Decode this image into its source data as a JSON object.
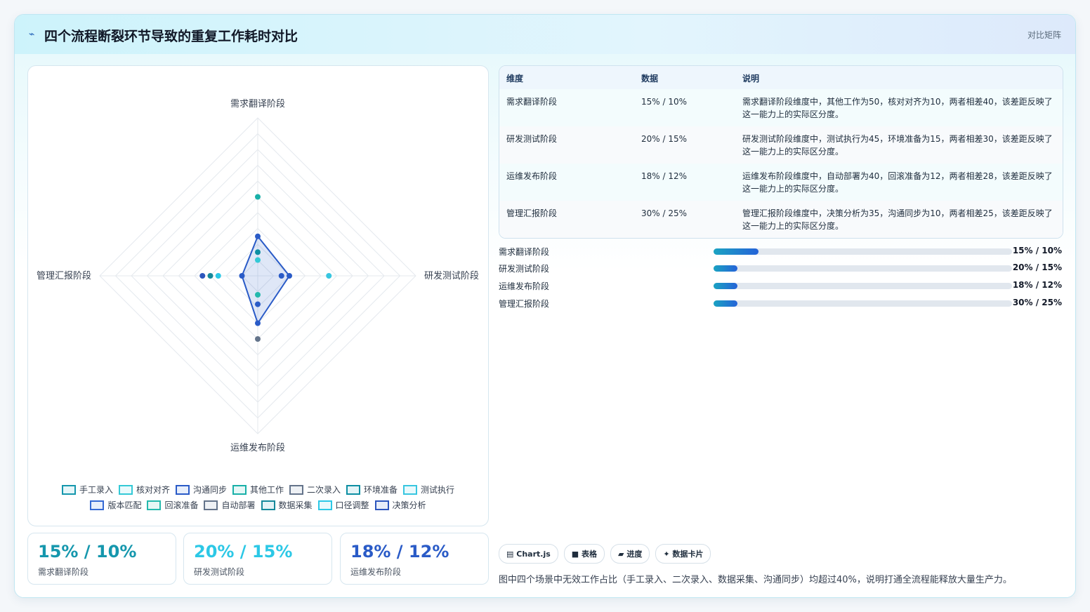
{
  "header": {
    "icon": "chart-line-icon",
    "title": "四个流程断裂环节导致的重复工作耗时对比",
    "tag": "对比矩阵"
  },
  "chart_data": {
    "type": "radar",
    "axes": [
      "需求翻译阶段",
      "研发测试阶段",
      "运维发布阶段",
      "管理汇报阶段"
    ],
    "rmax": 100,
    "rings": 10,
    "series": [
      {
        "name": "手工录入",
        "color": "#1597ad",
        "values": [
          null,
          null,
          null,
          null
        ]
      },
      {
        "name": "核对对齐",
        "color": "#34c9d6",
        "values": [
          10,
          null,
          null,
          null
        ]
      },
      {
        "name": "沟通同步",
        "color": "#2a5bc7",
        "values": [
          null,
          null,
          null,
          10
        ]
      },
      {
        "name": "其他工作",
        "color": "#19b0a8",
        "values": [
          50,
          null,
          null,
          null
        ]
      },
      {
        "name": "二次录入",
        "color": "#64748b",
        "values": [
          null,
          null,
          null,
          null
        ]
      },
      {
        "name": "环境准备",
        "color": "#0e8fa3",
        "values": [
          null,
          15,
          null,
          null
        ]
      },
      {
        "name": "测试执行",
        "color": "#38c6e0",
        "values": [
          null,
          45,
          null,
          null
        ]
      },
      {
        "name": "版本匹配",
        "color": "#3569d4",
        "values": [
          null,
          null,
          null,
          null
        ]
      },
      {
        "name": "回滚准备",
        "color": "#25b9ad",
        "values": [
          null,
          null,
          12,
          null
        ]
      },
      {
        "name": "自动部署",
        "color": "#64748b",
        "values": [
          null,
          null,
          40,
          null
        ]
      },
      {
        "name": "数据采集",
        "color": "#15899b",
        "values": [
          null,
          null,
          null,
          30
        ]
      },
      {
        "name": "口径调整",
        "color": "#2cc8e6",
        "values": [
          null,
          null,
          null,
          25
        ]
      },
      {
        "name": "决策分析",
        "color": "#2d56bd",
        "values": [
          null,
          null,
          null,
          35
        ]
      }
    ],
    "filled_series": {
      "color": "#2a5bc7",
      "values": [
        25,
        20,
        30,
        10
      ]
    },
    "extra_points": [
      {
        "axis": 0,
        "value": 15,
        "color": "#0e8fa3"
      },
      {
        "axis": 0,
        "value": 10,
        "color": "#34c9d6"
      },
      {
        "axis": 1,
        "value": 15,
        "color": "#2a5bc7"
      },
      {
        "axis": 2,
        "value": 18,
        "color": "#2a5bc7"
      },
      {
        "axis": 2,
        "value": 12,
        "color": "#25b9ad"
      },
      {
        "axis": 3,
        "value": 25,
        "color": "#2cc8e6"
      },
      {
        "axis": 3,
        "value": 30,
        "color": "#15899b"
      },
      {
        "axis": 3,
        "value": 35,
        "color": "#2d56bd"
      },
      {
        "axis": 1,
        "value": 45,
        "color": "#38c6e0"
      },
      {
        "axis": 2,
        "value": 40,
        "color": "#64748b"
      },
      {
        "axis": 0,
        "value": 50,
        "color": "#19b0a8"
      }
    ]
  },
  "legend": {
    "row1": [
      {
        "label": "手工录入",
        "border": "#1597ad",
        "fill": "#e6f6f9"
      },
      {
        "label": "核对对齐",
        "border": "#34c9d6",
        "fill": "#e9fafc"
      },
      {
        "label": "沟通同步",
        "border": "#2a5bc7",
        "fill": "#e7eefb"
      },
      {
        "label": "其他工作",
        "border": "#19b0a8",
        "fill": "#e6f7f6"
      },
      {
        "label": "二次录入",
        "border": "#64748b",
        "fill": "#eef1f5"
      },
      {
        "label": "环境准备",
        "border": "#0e8fa3",
        "fill": "#e4f4f7"
      },
      {
        "label": "测试执行",
        "border": "#38c6e0",
        "fill": "#e9f9fc"
      }
    ],
    "row2": [
      {
        "label": "版本匹配",
        "border": "#3569d4",
        "fill": "#e8eefb"
      },
      {
        "label": "回滚准备",
        "border": "#25b9ad",
        "fill": "#e6f7f5"
      },
      {
        "label": "自动部署",
        "border": "#64748b",
        "fill": "#eef1f5"
      },
      {
        "label": "数据采集",
        "border": "#15899b",
        "fill": "#e4f3f6"
      },
      {
        "label": "口径调整",
        "border": "#2cc8e6",
        "fill": "#e8f9fc"
      },
      {
        "label": "决策分析",
        "border": "#2d56bd",
        "fill": "#e7edf9"
      }
    ]
  },
  "stats": [
    {
      "value": "15% / 10%",
      "label": "需求翻译阶段",
      "color": "#1597ad"
    },
    {
      "value": "20% / 15%",
      "label": "研发测试阶段",
      "color": "#2cc8e6"
    },
    {
      "value": "18% / 12%",
      "label": "运维发布阶段",
      "color": "#2a5bc7"
    }
  ],
  "table": {
    "headers": [
      "维度",
      "数据",
      "说明"
    ],
    "rows": [
      {
        "dim": "需求翻译阶段",
        "data": "15% / 10%",
        "desc1": "需求翻译阶段维度中，其他工作为50，核对对齐为10，两者相差40，该差距反映了",
        "desc2": "这一能力上的实际区分度。"
      },
      {
        "dim": "研发测试阶段",
        "data": "20% / 15%",
        "desc1": "研发测试阶段维度中，测试执行为45，环境准备为15，两者相差30，该差距反映了",
        "desc2": "这一能力上的实际区分度。"
      },
      {
        "dim": "运维发布阶段",
        "data": "18% / 12%",
        "desc1": "运维发布阶段维度中，自动部署为40，回滚准备为12，两者相差28，该差距反映了",
        "desc2": "这一能力上的实际区分度。"
      },
      {
        "dim": "管理汇报阶段",
        "data": "30% / 25%",
        "desc1": "管理汇报阶段维度中，决策分析为35，沟通同步为10，两者相差25，该差距反映了",
        "desc2": "这一能力上的实际区分度。"
      }
    ]
  },
  "progress": [
    {
      "label": "需求翻译阶段",
      "value": "15% / 10%",
      "fraction": 0.15
    },
    {
      "label": "研发测试阶段",
      "value": "20% / 15%",
      "fraction": 0.08
    },
    {
      "label": "运维发布阶段",
      "value": "18% / 12%",
      "fraction": 0.08
    },
    {
      "label": "管理汇报阶段",
      "value": "30% / 25%",
      "fraction": 0.08
    }
  ],
  "chips": [
    {
      "icon": "chart-icon",
      "glyph": "▤",
      "label": "Chart.js"
    },
    {
      "icon": "table-icon",
      "glyph": "■",
      "label": "表格"
    },
    {
      "icon": "progress-icon",
      "glyph": "▰",
      "label": "进度"
    },
    {
      "icon": "card-icon",
      "glyph": "✦",
      "label": "数据卡片"
    }
  ],
  "footnote": "图中四个场景中无效工作占比（手工录入、二次录入、数据采集、沟通同步）均超过40%，说明打通全流程能释放大量生产力。"
}
